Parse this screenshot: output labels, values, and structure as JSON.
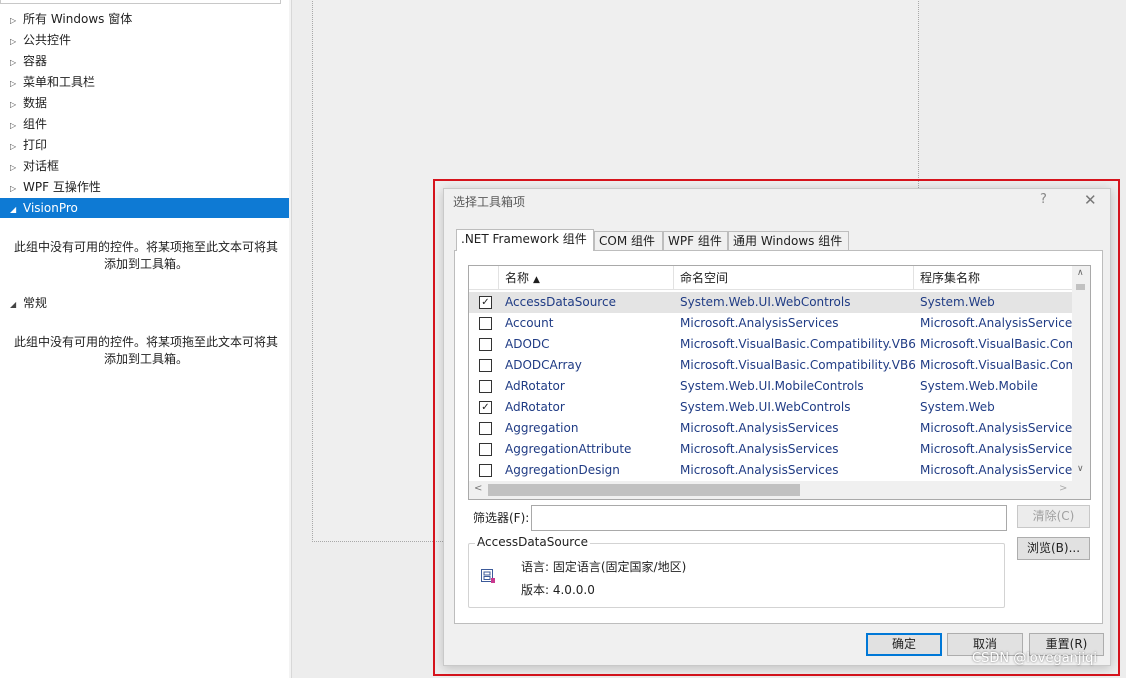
{
  "toolbox": {
    "categories": [
      {
        "label": "所有 Windows 窗体",
        "expanded": false
      },
      {
        "label": "公共控件",
        "expanded": false
      },
      {
        "label": "容器",
        "expanded": false
      },
      {
        "label": "菜单和工具栏",
        "expanded": false
      },
      {
        "label": "数据",
        "expanded": false
      },
      {
        "label": "组件",
        "expanded": false
      },
      {
        "label": "打印",
        "expanded": false
      },
      {
        "label": "对话框",
        "expanded": false
      },
      {
        "label": "WPF 互操作性",
        "expanded": false
      },
      {
        "label": "VisionPro",
        "expanded": true,
        "selected": true
      },
      {
        "label": "常规",
        "expanded": true
      }
    ],
    "empty_message_line1": "此组中没有可用的控件。将某项拖至此文本可将其",
    "empty_message_line2": "添加到工具箱。"
  },
  "dialog": {
    "title": "选择工具箱项",
    "help_glyph": "?",
    "close_glyph": "✕",
    "tabs": [
      ".NET Framework 组件",
      "COM 组件",
      "WPF 组件",
      "通用 Windows 组件"
    ],
    "active_tab": 0,
    "columns": {
      "name": "名称",
      "namespace": "命名空间",
      "assembly": "程序集名称",
      "sort_glyph": "▲"
    },
    "rows": [
      {
        "checked": true,
        "name": "AccessDataSource",
        "namespace": "System.Web.UI.WebControls",
        "assembly": "System.Web",
        "selected": true
      },
      {
        "checked": false,
        "name": "Account",
        "namespace": "Microsoft.AnalysisServices",
        "assembly": "Microsoft.AnalysisServices"
      },
      {
        "checked": false,
        "name": "ADODC",
        "namespace": "Microsoft.VisualBasic.Compatibility.VB6",
        "assembly": "Microsoft.VisualBasic.Compatibility"
      },
      {
        "checked": false,
        "name": "ADODCArray",
        "namespace": "Microsoft.VisualBasic.Compatibility.VB6",
        "assembly": "Microsoft.VisualBasic.Compatibility"
      },
      {
        "checked": false,
        "name": "AdRotator",
        "namespace": "System.Web.UI.MobileControls",
        "assembly": "System.Web.Mobile"
      },
      {
        "checked": true,
        "name": "AdRotator",
        "namespace": "System.Web.UI.WebControls",
        "assembly": "System.Web"
      },
      {
        "checked": false,
        "name": "Aggregation",
        "namespace": "Microsoft.AnalysisServices",
        "assembly": "Microsoft.AnalysisServices"
      },
      {
        "checked": false,
        "name": "AggregationAttribute",
        "namespace": "Microsoft.AnalysisServices",
        "assembly": "Microsoft.AnalysisServices"
      },
      {
        "checked": false,
        "name": "AggregationDesign",
        "namespace": "Microsoft.AnalysisServices",
        "assembly": "Microsoft.AnalysisServices"
      }
    ],
    "filter": {
      "label": "筛选器(F):",
      "value": "",
      "clear_label": "清除(C)"
    },
    "details": {
      "title": "AccessDataSource",
      "language": "语言:  固定语言(固定国家/地区)",
      "version": "版本:  4.0.0.0",
      "icon": "datasource-icon"
    },
    "browse_label": "浏览(B)...",
    "ok_label": "确定",
    "cancel_label": "取消",
    "reset_label": "重置(R)"
  },
  "watermark": "CSDN @loveganjiqi",
  "colors": {
    "selection": "#0e7ad4",
    "highlight_border": "#d6141d",
    "link_text": "#1f3b84"
  }
}
